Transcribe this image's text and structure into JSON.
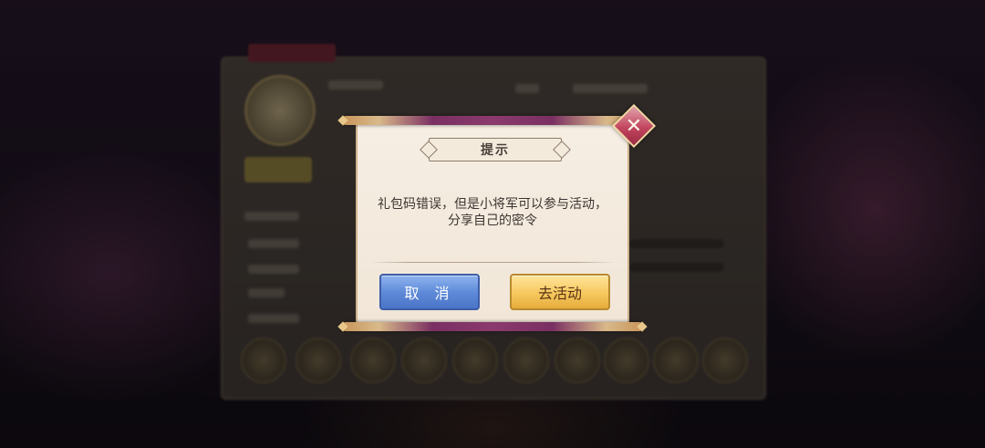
{
  "dialog": {
    "title": "提示",
    "message_line1": "礼包码错误，但是小将军可以参与活动，",
    "message_line2": "分享自己的密令",
    "cancel_label": "取 消",
    "confirm_label": "去活动",
    "close_label": "✕"
  },
  "colors": {
    "cancel_button": "#5f8bd9",
    "confirm_button": "#f6c85e",
    "close_button": "#c2455e",
    "dialog_background": "#f3e9dc"
  },
  "icons": {
    "close": "close-icon"
  }
}
